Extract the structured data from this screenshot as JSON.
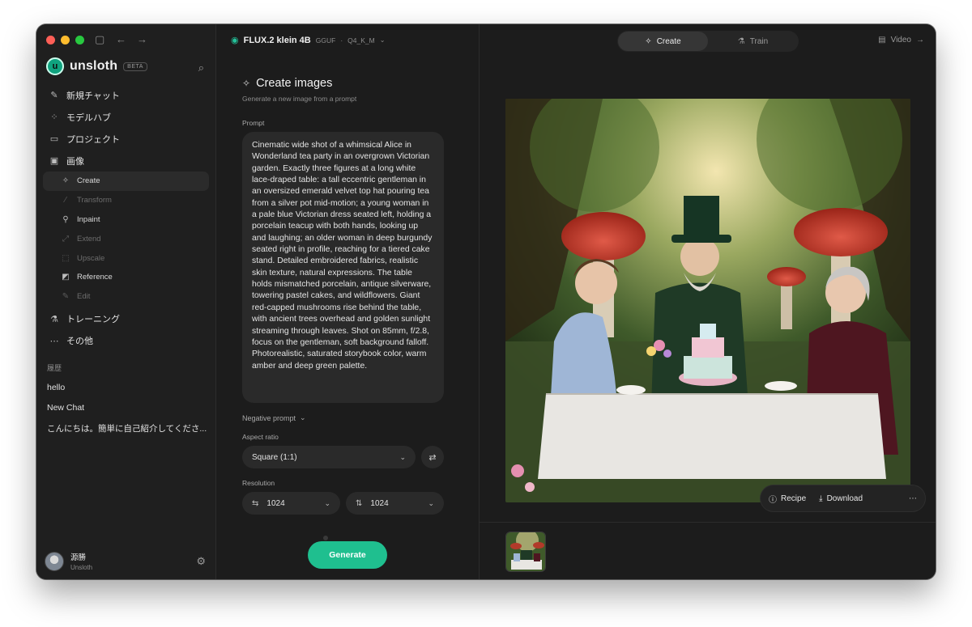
{
  "app": {
    "name": "unsloth",
    "badge": "BETA"
  },
  "sidebar": {
    "nav": [
      {
        "label": "新規チャット",
        "icon": "edit-icon"
      },
      {
        "label": "モデルハブ",
        "icon": "grid-icon"
      },
      {
        "label": "プロジェクト",
        "icon": "folder-icon"
      },
      {
        "label": "画像",
        "icon": "image-icon"
      }
    ],
    "image_sub": [
      {
        "label": "Create",
        "state": "active"
      },
      {
        "label": "Transform",
        "state": "dim"
      },
      {
        "label": "Inpaint",
        "state": "normal"
      },
      {
        "label": "Extend",
        "state": "dim"
      },
      {
        "label": "Upscale",
        "state": "dim"
      },
      {
        "label": "Reference",
        "state": "normal"
      },
      {
        "label": "Edit",
        "state": "dim"
      }
    ],
    "nav_bottom": [
      {
        "label": "トレーニング",
        "icon": "flask-icon"
      },
      {
        "label": "その他",
        "icon": "more-icon"
      }
    ],
    "history_title": "履歴",
    "history": [
      "hello",
      "New Chat",
      "こんにちは。簡単に自己紹介してくださ..."
    ],
    "user": {
      "name": "源勝",
      "org": "Unsloth"
    }
  },
  "model": {
    "name": "FLUX.2 klein 4B",
    "format": "GGUF",
    "quant": "Q4_K_M"
  },
  "panel": {
    "title": "Create images",
    "subtitle": "Generate a new image from a prompt",
    "prompt_label": "Prompt",
    "prompt": "Cinematic wide shot of a whimsical Alice in Wonderland tea party in an overgrown Victorian garden. Exactly three figures at a long white lace-draped table: a tall eccentric gentleman in an oversized emerald velvet top hat pouring tea from a silver pot mid-motion; a young woman in a pale blue Victorian dress seated left, holding a porcelain teacup with both hands, looking up and laughing; an older woman in deep burgundy seated right in profile, reaching for a tiered cake stand. Detailed embroidered fabrics, realistic skin texture, natural expressions. The table holds mismatched porcelain, antique silverware, towering pastel cakes, and wildflowers. Giant red-capped mushrooms rise behind the table, with ancient trees overhead and golden sunlight streaming through leaves. Shot on 85mm, f/2.8, focus on the gentleman, soft background falloff. Photorealistic, saturated storybook color, warm amber and deep green palette.",
    "negative_prompt_label": "Negative prompt",
    "aspect_label": "Aspect ratio",
    "aspect_value": "Square (1:1)",
    "resolution_label": "Resolution",
    "width": "1024",
    "height": "1024",
    "generate": "Generate"
  },
  "right": {
    "tabs": [
      {
        "label": "Create",
        "active": true
      },
      {
        "label": "Train",
        "active": false
      }
    ],
    "video": "Video",
    "toolbar": {
      "recipe": "Recipe",
      "download": "Download"
    }
  }
}
